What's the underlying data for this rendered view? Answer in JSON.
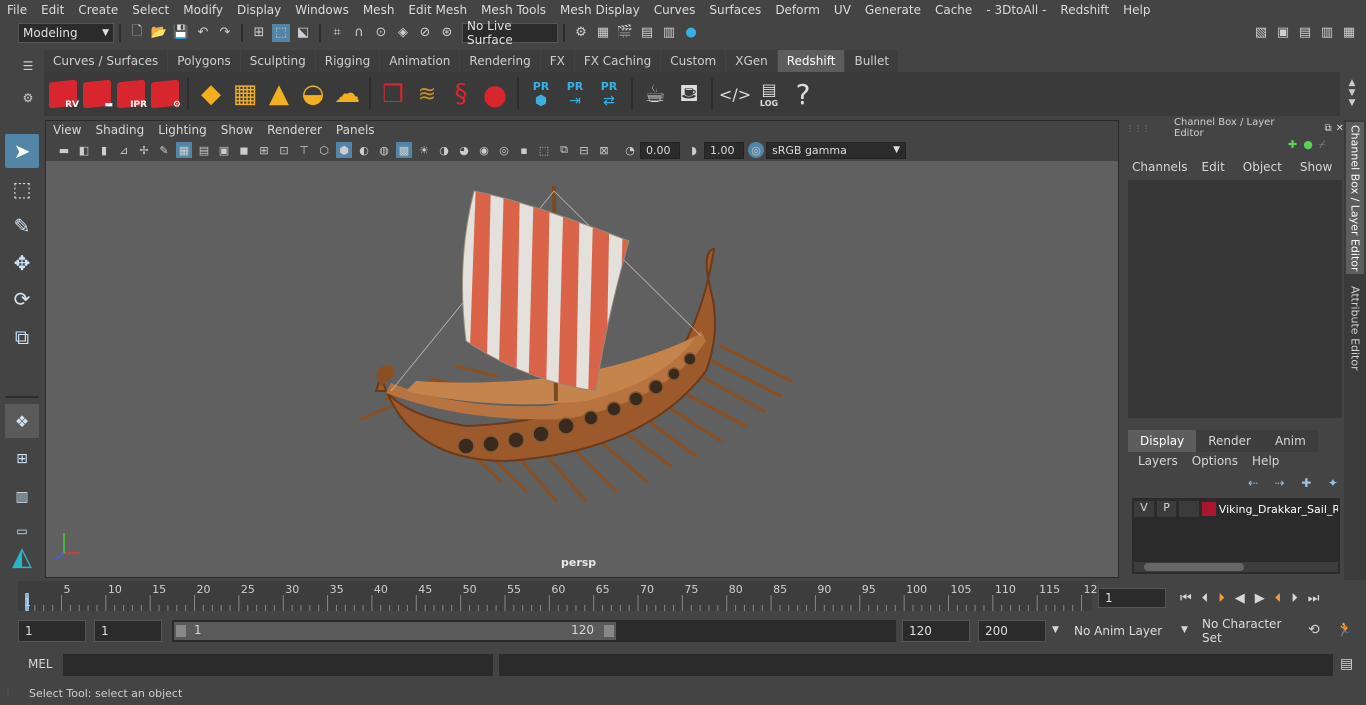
{
  "menubar": [
    "File",
    "Edit",
    "Create",
    "Select",
    "Modify",
    "Display",
    "Windows",
    "Mesh",
    "Edit Mesh",
    "Mesh Tools",
    "Mesh Display",
    "Curves",
    "Surfaces",
    "Deform",
    "UV",
    "Generate",
    "Cache",
    "- 3DtoAll -",
    "Redshift",
    "Help"
  ],
  "status_line": {
    "workspace": "Modeling",
    "live_surface": "No Live Surface"
  },
  "shelf_tabs": [
    "Curves / Surfaces",
    "Polygons",
    "Sculpting",
    "Rigging",
    "Animation",
    "Rendering",
    "FX",
    "FX Caching",
    "Custom",
    "XGen",
    "Redshift",
    "Bullet"
  ],
  "shelf_active_tab": "Redshift",
  "shelf_icons": {
    "rv": "RV",
    "ipr": "IPR",
    "pr": "PR",
    "log": "LOG",
    "help": "?"
  },
  "viewport": {
    "menu": [
      "View",
      "Shading",
      "Lighting",
      "Show",
      "Renderer",
      "Panels"
    ],
    "exposure": "0.00",
    "gamma": "1.00",
    "color_space": "sRGB gamma",
    "camera_label": "persp"
  },
  "channel_box": {
    "title": "Channel Box / Layer Editor",
    "menu": [
      "Channels",
      "Edit",
      "Object",
      "Show"
    ]
  },
  "layer_editor": {
    "tabs": [
      "Display",
      "Render",
      "Anim"
    ],
    "active_tab": "Display",
    "menu": [
      "Layers",
      "Options",
      "Help"
    ],
    "layers": [
      {
        "visible": "V",
        "playback": "P",
        "name": "Viking_Drakkar_Sail_R",
        "color": "#a81630"
      }
    ]
  },
  "side_tabs": [
    "Channel Box / Layer Editor",
    "Attribute Editor"
  ],
  "timeline": {
    "ticks": [
      "5",
      "10",
      "15",
      "20",
      "25",
      "30",
      "35",
      "40",
      "45",
      "50",
      "55",
      "60",
      "65",
      "70",
      "75",
      "80",
      "85",
      "90",
      "95",
      "100",
      "105",
      "110",
      "115",
      "12"
    ],
    "start_marker": "1",
    "current_frame": "1"
  },
  "range": {
    "start": "1",
    "playback_start": "1",
    "slider_start": "1",
    "slider_end": "120",
    "playback_end": "120",
    "end": "200",
    "anim_layer": "No Anim Layer",
    "character_set": "No Character Set"
  },
  "command_line": {
    "language": "MEL"
  },
  "help_line": "Select Tool: select an object",
  "colors": {
    "accent_blue": "#5285a6",
    "redshift_red": "#d8262f"
  }
}
